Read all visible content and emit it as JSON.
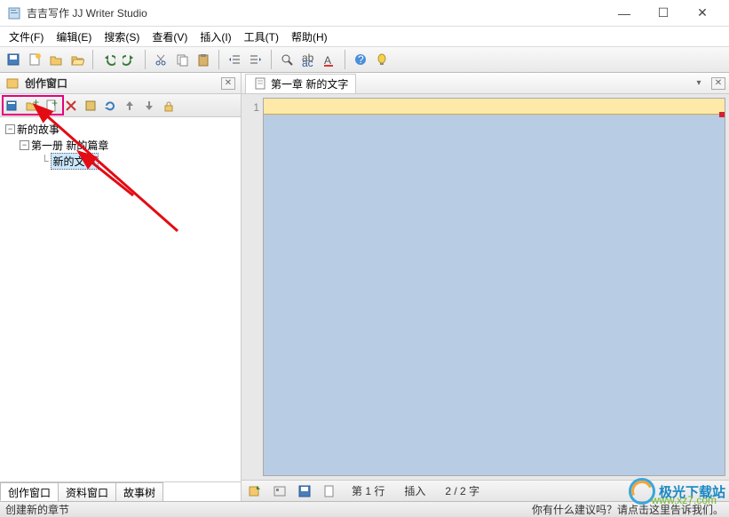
{
  "window": {
    "title": "吉吉写作 JJ Writer Studio"
  },
  "menus": [
    "文件(F)",
    "编辑(E)",
    "搜索(S)",
    "查看(V)",
    "插入(I)",
    "工具(T)",
    "帮助(H)"
  ],
  "side_panel": {
    "title": "创作窗口",
    "toolbar_icons": [
      "book-icon",
      "folder-add-icon",
      "page-add-icon",
      "delete-icon",
      "book2-icon",
      "refresh-icon",
      "up-icon",
      "down-icon",
      "lock-icon"
    ]
  },
  "tree": {
    "root": {
      "label": "新的故事"
    },
    "chapter": {
      "label": "第一册 新的篇章"
    },
    "doc": {
      "label": "新的文字"
    }
  },
  "side_tabs": [
    "创作窗口",
    "资料窗口",
    "故事树"
  ],
  "doc_tab": {
    "label": "第一章 新的文字"
  },
  "editor": {
    "line_number": "1"
  },
  "bottom": {
    "line_info": "第 1 行",
    "mode": "插入",
    "chars": "2 / 2 字"
  },
  "status": {
    "left": "创建新的章节",
    "right": "你有什么建议吗？请点击这里告诉我们。"
  },
  "watermark": {
    "text1": "极光下载站",
    "text2": "www.xz7.com"
  }
}
